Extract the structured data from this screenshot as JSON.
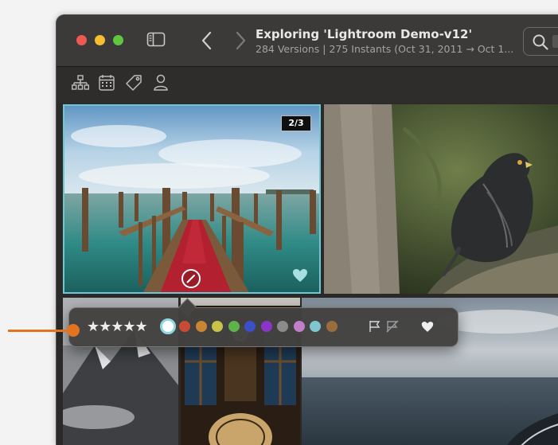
{
  "window": {
    "title": "Exploring 'Lightroom Demo-v12'",
    "subtitle": "284 Versions | 275 Instants (Oct 31, 2011 → Oct 1..."
  },
  "toolbar": {
    "icons": [
      "hierarchy-icon",
      "calendar-icon",
      "tag-icon",
      "person-icon"
    ]
  },
  "grid": {
    "selected_photo_badge": "2/3"
  },
  "rating_popover": {
    "stars": "★★★★★",
    "colors": [
      "#ffffff",
      "#c94a35",
      "#c98533",
      "#c6c24a",
      "#5eb24a",
      "#3b4fc7",
      "#8a35c7",
      "#8b8b8b",
      "#c27fc9",
      "#80c6cf",
      "#9b6d3c"
    ],
    "selected_color_index": 0
  },
  "accent_colors": {
    "selection": "#6fc7d3",
    "callout": "#e3731f"
  }
}
